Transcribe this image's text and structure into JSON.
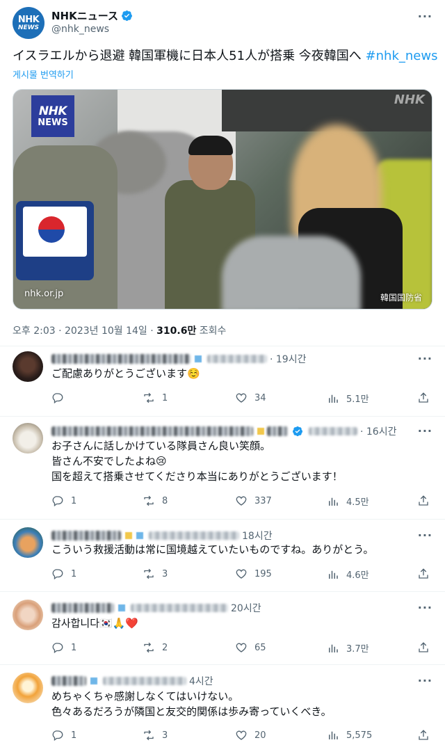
{
  "post": {
    "author_name": "NHKニュース",
    "author_handle": "@nhk_news",
    "avatar_text_top": "NHK",
    "avatar_text_bottom": "NEWS",
    "text": "イスラエルから退避 韓国軍機に日本人51人が搭乗 今夜韓国へ",
    "hashtag": "#nhk_news",
    "translate_label": "게시물 번역하기",
    "media": {
      "badge_top": "NHK",
      "badge_bottom": "NEWS",
      "watermark": "NHK",
      "source": "nhk.or.jp",
      "credit": "韓国国防省"
    },
    "timestamp": "오후 2:03 · 2023년 10월 14일 · ",
    "views_count": "310.6만",
    "views_label": " 조회수"
  },
  "replies": [
    {
      "time": "· 19시간",
      "text_lines": [
        "ご配慮ありがとうございます☺️"
      ],
      "replies": "",
      "retweets": "1",
      "likes": "34",
      "views": "5.1만"
    },
    {
      "time": "· 16시간",
      "text_lines": [
        "お子さんに話しかけている隊員さん良い笑顔。",
        "皆さん不安でしたよね😢",
        "国を超えて搭乗させてくださり本当にありがとうございます！"
      ],
      "replies": "1",
      "retweets": "8",
      "likes": "337",
      "views": "4.5만"
    },
    {
      "time": "18시간",
      "text_lines": [
        "こういう救援活動は常に国境越えていたいものですね。ありがとう。"
      ],
      "replies": "1",
      "retweets": "3",
      "likes": "195",
      "views": "4.6만"
    },
    {
      "time": "20시간",
      "text_lines": [
        "감사합니다🇰🇷🙏❤️"
      ],
      "replies": "1",
      "retweets": "2",
      "likes": "65",
      "views": "3.7만"
    },
    {
      "time": "4시간",
      "text_lines": [
        "めちゃくちゃ感謝しなくてはいけない。",
        "色々あるだろうが隣国と友交的関係は歩み寄っていくべき。"
      ],
      "replies": "1",
      "retweets": "3",
      "likes": "20",
      "views": "5,575"
    }
  ],
  "colors": {
    "accent": "#1d9bf0",
    "text_secondary": "#536471",
    "divider": "#eff3f4",
    "nhk_blue": "#2c3d9c"
  },
  "icons": [
    "verified-badge-icon",
    "more-icon",
    "reply-icon",
    "retweet-icon",
    "like-icon",
    "views-icon",
    "share-icon"
  ]
}
